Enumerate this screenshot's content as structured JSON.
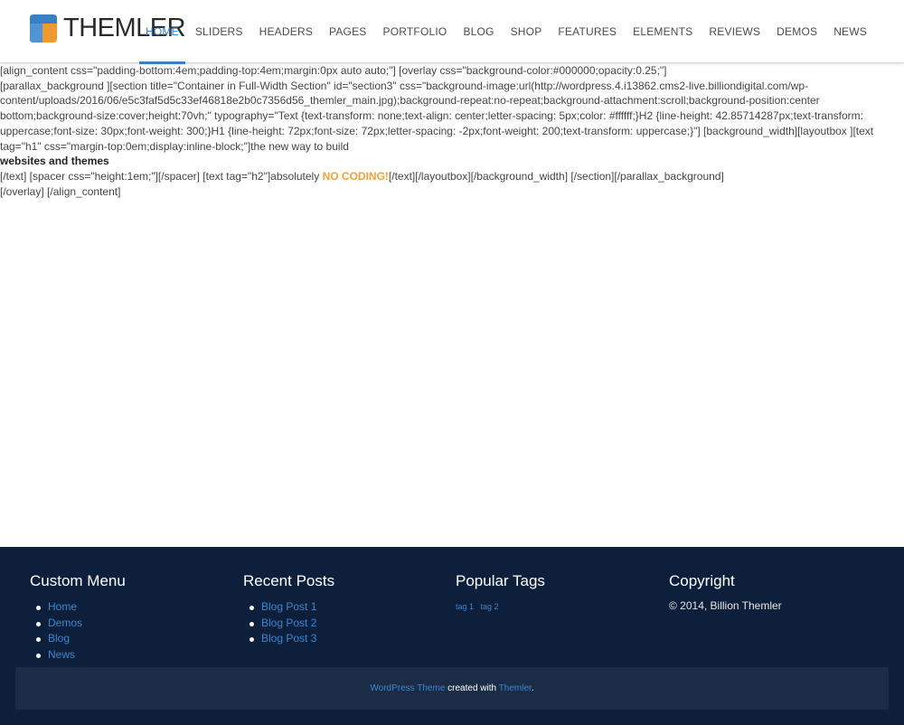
{
  "brand": {
    "name": "THEMLER",
    "colors": {
      "blue": "#3a7fc1",
      "orange": "#f09a2e",
      "footer_bg": "#0e1f3b"
    }
  },
  "nav": {
    "items": [
      {
        "label": "HOME",
        "active": true
      },
      {
        "label": "SLIDERS"
      },
      {
        "label": "HEADERS"
      },
      {
        "label": "PAGES"
      },
      {
        "label": "PORTFOLIO"
      },
      {
        "label": "BLOG"
      },
      {
        "label": "SHOP"
      },
      {
        "label": "FEATURES"
      },
      {
        "label": "ELEMENTS"
      },
      {
        "label": "REVIEWS"
      },
      {
        "label": "DEMOS"
      },
      {
        "label": "NEWS"
      }
    ]
  },
  "content": {
    "line1": "[align_content css=\"padding-bottom:4em;padding-top:4em;margin:0px auto auto;\"] [overlay css=\"background-color:#000000;opacity:0.25;\"]",
    "line2": "[parallax_background ][section title=\"Container in Full-Width Section\" id=\"section3\" css=\"background-image:url(http://wordpress.4.i13862.cms2-live.billiondigital.com/wp-content/uploads/2016/06/e5c3faf5d5c33ef46818e2b0c7356d56_themler_main.jpg);background-repeat:no-repeat;background-attachment:scroll;background-position:center bottom;background-size:cover;height:70vh;\" typography=\"Text {text-transform: none;text-align: center;letter-spacing: 5px;color: #ffffff;}H2 {line-height: 42.85714287px;text-transform: uppercase;font-size: 30px;font-weight: 300;}H1 {line-height: 72px;font-size: 72px;letter-spacing: -2px;font-weight: 200;text-transform: uppercase;}\"] [background_width][layoutbox ][text tag=\"h1\" css=\"margin-top:0em;display:inline-block;\"]the new way to build",
    "bold_line": "websites and themes",
    "line4_before": "[/text] [spacer css=\"height:1em;\"][/spacer] [text tag=\"h2\"]absolutely ",
    "line4_highlight": "NO CODING!",
    "line4_after": "[/text][/layoutbox][/background_width] [/section][/parallax_background]",
    "line5": "[/overlay] [/align_content]"
  },
  "footer": {
    "custom_menu": {
      "title": "Custom Menu",
      "items": [
        "Home",
        "Demos",
        "Blog",
        "News"
      ]
    },
    "recent_posts": {
      "title": "Recent Posts",
      "items": [
        "Blog Post 1",
        "Blog Post 2",
        "Blog Post 3"
      ]
    },
    "popular_tags": {
      "title": "Popular Tags",
      "tags": [
        "tag 1",
        "tag 2"
      ]
    },
    "copyright": {
      "title": "Copyright",
      "text": "© 2014, Billion Themler"
    },
    "bottom": {
      "link1": "WordPress Theme",
      "middle": " created with ",
      "link2": "Themler",
      "end": "."
    }
  }
}
